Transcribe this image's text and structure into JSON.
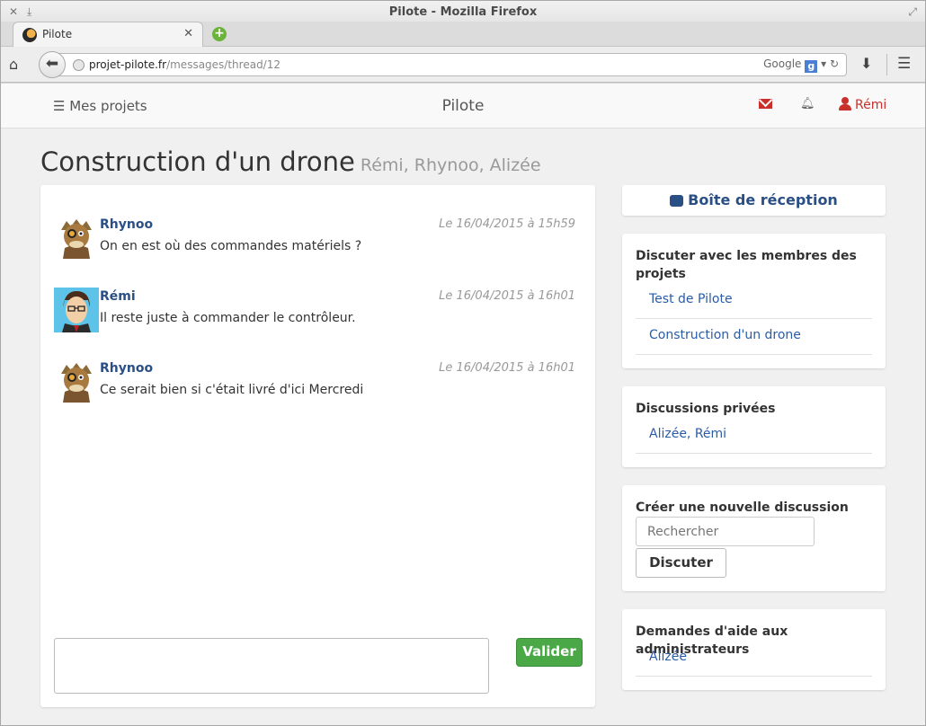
{
  "window": {
    "title": "Pilote - Mozilla Firefox"
  },
  "tab": {
    "label": "Pilote",
    "close": "✕",
    "new_tab_icon": "plus-icon"
  },
  "urlbar": {
    "host": "projet-pilote.fr",
    "path": "/messages/thread/12",
    "search_engine": "Google"
  },
  "nav": {
    "projects_label": "Mes projets",
    "brand": "Pilote",
    "user": "Rémi",
    "icons": [
      "list-icon",
      "envelope-icon",
      "bell-icon",
      "user-icon"
    ]
  },
  "thread": {
    "title": "Construction d'un drone",
    "participants": "Rémi, Rhynoo, Alizée",
    "messages": [
      {
        "author": "Rhynoo",
        "time": "Le 16/04/2015 à 15h59",
        "text": "On en est où des commandes matériels ?",
        "avatar": "rhynoo-avatar"
      },
      {
        "author": "Rémi",
        "time": "Le 16/04/2015 à 16h01",
        "text": "Il reste juste à commander le contrôleur.",
        "avatar": "remi-avatar"
      },
      {
        "author": "Rhynoo",
        "time": "Le 16/04/2015 à 16h01",
        "text": "Ce serait bien si c'était livré d'ici Mercredi",
        "avatar": "rhynoo-avatar"
      }
    ],
    "composer_value": "",
    "submit_label": "Valider"
  },
  "sidebar": {
    "inbox_label": "Boîte de réception",
    "members": {
      "heading": "Discuter avec les membres des projets",
      "items": [
        "Test de Pilote",
        "Construction d'un drone"
      ]
    },
    "private": {
      "heading": "Discussions privées",
      "items": [
        "Alizée, Rémi"
      ]
    },
    "new_discussion": {
      "heading": "Créer une nouvelle discussion",
      "placeholder": "Rechercher",
      "button": "Discuter"
    },
    "admin_help": {
      "heading": "Demandes d'aide aux administrateurs",
      "items": [
        "Alizée"
      ]
    }
  },
  "colors": {
    "link": "#2a5ca8",
    "author": "#2a4f85",
    "danger": "#c9302c",
    "success": "#4aa847"
  }
}
